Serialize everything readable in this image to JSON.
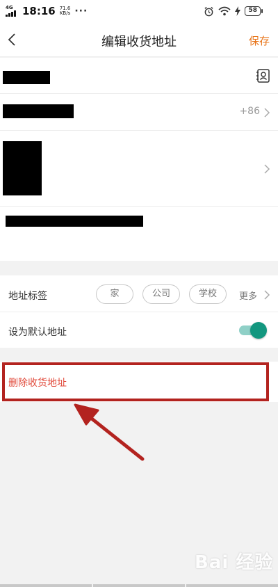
{
  "status_bar": {
    "network": "4G",
    "time": "18:16",
    "speed_value": "71.6",
    "speed_unit": "KB/s",
    "more_dots": "···",
    "battery": "58"
  },
  "header": {
    "title": "编辑收货地址",
    "save_label": "保存"
  },
  "form": {
    "country_code": "+86"
  },
  "address_tag": {
    "label": "地址标签",
    "chips": [
      "家",
      "公司",
      "学校"
    ],
    "more": "更多"
  },
  "default_address": {
    "label": "设为默认地址",
    "enabled": true
  },
  "delete": {
    "label": "删除收货地址"
  },
  "colors": {
    "accent": "#e8751a",
    "delete_text": "#e14a3b",
    "toggle_on": "#13977f",
    "annotation": "#b3231f"
  },
  "watermark": "Bai 经验"
}
